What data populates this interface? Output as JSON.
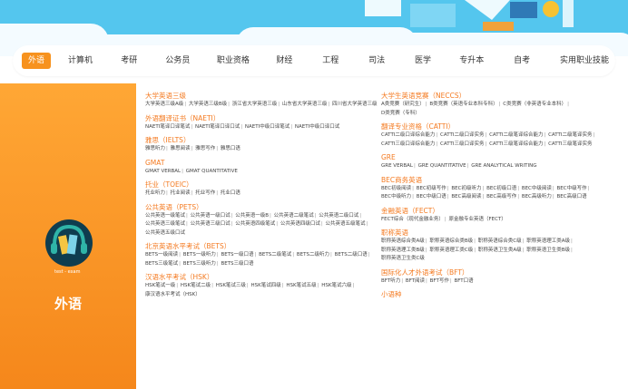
{
  "nav": [
    "外语",
    "计算机",
    "考研",
    "公务员",
    "职业资格",
    "财经",
    "工程",
    "司法",
    "医学",
    "专升本",
    "自考",
    "实用职业技能"
  ],
  "active_nav_index": 0,
  "left": {
    "title": "外语",
    "emblem_text": "test - exam"
  },
  "col1": [
    {
      "title": "大学英语三级",
      "items": [
        "大学英语三级A级",
        "大学英语三级B级",
        "浙江省大学英语三级",
        "山东省大学英语三级",
        "四川省大学英语三级"
      ]
    },
    {
      "title": "外语翻译证书（NAETI）",
      "items": [
        "NAETI笔译口译笔试",
        "NAETI笔译口译口试",
        "NAETI中级口译笔试",
        "NAETI中级口译口试"
      ]
    },
    {
      "title": "雅思（IELTS）",
      "items": [
        "雅思听力",
        "雅思阅读",
        "雅思写作",
        "雅思口语"
      ]
    },
    {
      "title": "GMAT",
      "items": [
        "GMAT VERBAL",
        "GMAT QUANTITATIVE"
      ]
    },
    {
      "title": "托业（TOEIC）",
      "items": [
        "托业听力",
        "托业阅读",
        "托业写作",
        "托业口语"
      ]
    },
    {
      "title": "公共英语（PETS）",
      "items": [
        "公共英语一级笔试",
        "公共英语一级口试",
        "公共英语一级B",
        "公共英语二级笔试",
        "公共英语二级口试",
        "公共英语三级笔试",
        "公共英语三级口试",
        "公共英语四级笔试",
        "公共英语四级口试",
        "公共英语五级笔试",
        "公共英语五级口试"
      ]
    },
    {
      "title": "北京英语水平考试（BETS）",
      "items": [
        "BETS一级阅读",
        "BETS一级听力",
        "BETS一级口语",
        "BETS二级笔试",
        "BETS二级听力",
        "BETS二级口语",
        "BETS三级笔试",
        "BETS三级听力",
        "BETS三级口语"
      ]
    },
    {
      "title": "汉语水平考试（HSK）",
      "items": [
        "HSK笔试一级",
        "HSK笔试二级",
        "HSK笔试三级",
        "HSK笔试四级",
        "HSK笔试五级",
        "HSK笔试六级",
        "康汉语水平考试（HSK）"
      ]
    }
  ],
  "col2": [
    {
      "title": "大学生英语竞赛（NECCS）",
      "items": [
        "A类竞赛（研究生）",
        "B类竞赛（英语专业本科专科）",
        "C类竞赛（非英语专业本科）",
        "D类竞赛（专科）"
      ]
    },
    {
      "title": "翻译专业资格（CATTI）",
      "items": [
        "CATTI二级口译综合能力",
        "CATTI二级口译实务",
        "CATTI二级笔译综合能力",
        "CATTI二级笔译实务",
        "CATTI三级口译综合能力",
        "CATTI三级口译实务",
        "CATTI三级笔译综合能力",
        "CATTI三级笔译实务"
      ]
    },
    {
      "title": "GRE",
      "items": [
        "GRE VERBAL",
        "GRE QUANTITATIVE",
        "GRE ANALYTICAL WRITING"
      ]
    },
    {
      "title": "BEC商务英语",
      "items": [
        "BEC初级阅读",
        "BEC初级写作",
        "BEC初级听力",
        "BEC初级口语",
        "BEC中级阅读",
        "BEC中级写作",
        "BEC中级听力",
        "BEC中级口语",
        "BEC高级阅读",
        "BEC高级写作",
        "BEC高级听力",
        "BEC高级口语"
      ]
    },
    {
      "title": "金融英语（FECT）",
      "items": [
        "FECT综合（现代金融业务）",
        "原金融专业英语（FECT）"
      ]
    },
    {
      "title": "职称英语",
      "items": [
        "职称英语综合类A级",
        "职称英语综合类B级",
        "职称英语综合类C级",
        "职称英语理工类A级",
        "职称英语理工类B级",
        "职称英语理工类C级",
        "职称英语卫生类A级",
        "职称英语卫生类B级",
        "职称英语卫生类C级"
      ]
    },
    {
      "title": "国际化人才外语考试（BFT）",
      "items": [
        "BFT听力",
        "BFT阅读",
        "BFT写作",
        "BFT口语"
      ]
    },
    {
      "title": "小语种",
      "items": []
    }
  ]
}
